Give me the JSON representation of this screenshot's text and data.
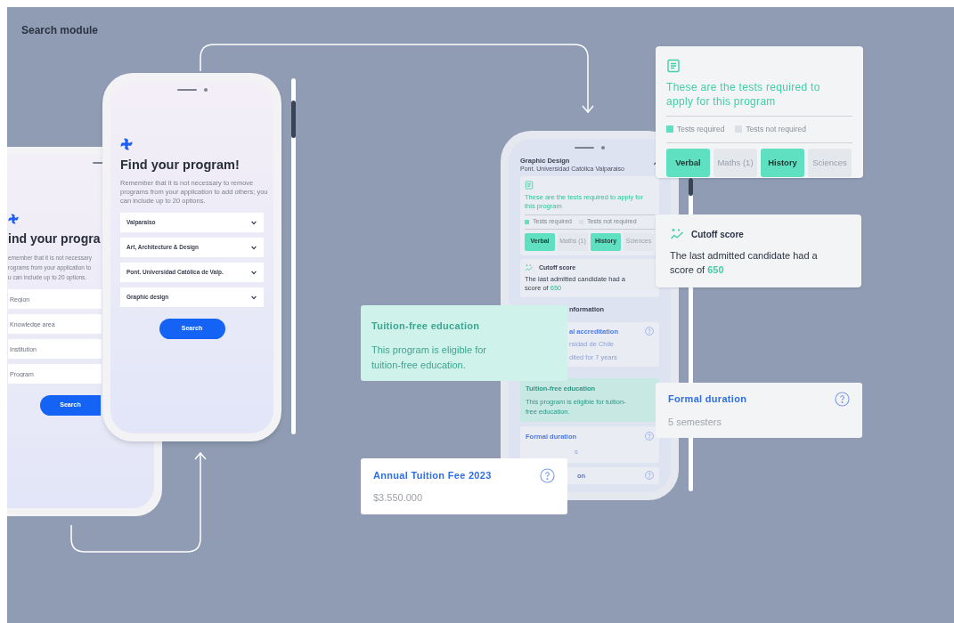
{
  "title": "Search module",
  "phone_left": {
    "heading": "ind your progra",
    "description_lines": [
      "emember that it is not necessary",
      "rograms from your application to",
      "u can include up to 20 options."
    ],
    "fields": [
      {
        "placeholder": "Region"
      },
      {
        "placeholder": "Knowledge area"
      },
      {
        "placeholder": "Institution"
      },
      {
        "placeholder": "Program"
      }
    ],
    "button": "Search"
  },
  "phone_main": {
    "heading": "Find your program!",
    "description": "Remember that it is not necessary to remove programs from your application to add others; you can include up to 20 options.",
    "selects": [
      {
        "value": "Valparaiso"
      },
      {
        "value": "Art, Architecture & Design"
      },
      {
        "value": "Pont. Universidad Católica de Valp."
      },
      {
        "value": "Graphic design"
      }
    ],
    "button": "Search"
  },
  "phone_detail": {
    "program": "Graphic Design",
    "institution": "Pont. Universidad Católica Valparaiso",
    "expanded": true,
    "tests": {
      "title": "These are the tests required to apply for this program",
      "legend": [
        {
          "label": "Tests required",
          "color": "#5fe0c0"
        },
        {
          "label": "Tests not required",
          "color": "#dcdfe5"
        }
      ],
      "chips": [
        {
          "label": "Verbal",
          "required": true
        },
        {
          "label": "Maths (1)",
          "required": false
        },
        {
          "label": "History",
          "required": true
        },
        {
          "label": "Sciences",
          "required": false
        }
      ]
    },
    "cutoff": {
      "title": "Cutoff score",
      "text": "The last admitted candidate had a score of",
      "score": "650"
    },
    "general_info": "nformation",
    "accreditation": {
      "title": "al accreditation",
      "lines": [
        "rsidad de Chile",
        "dited for 7 years"
      ]
    },
    "tuition_free": {
      "title": "Tuition-free education",
      "text": "This program is eligible for tuition-free education."
    },
    "formal_duration": {
      "title": "Formal duration",
      "value": "s"
    },
    "last_item": "on"
  },
  "cards": {
    "tests": {
      "title": "These are the tests required to apply for this program",
      "legend": [
        {
          "label": "Tests required",
          "color": "#5fe0c0"
        },
        {
          "label": "Tests not required",
          "color": "#dcdfe5"
        }
      ],
      "chips": [
        {
          "label": "Verbal",
          "required": true
        },
        {
          "label": "Maths (1)",
          "required": false
        },
        {
          "label": "History",
          "required": true
        },
        {
          "label": "Sciences",
          "required": false
        }
      ]
    },
    "cutoff": {
      "title": "Cutoff score",
      "text": "The last admitted candidate had a score of",
      "score": "650"
    },
    "tuition_free": {
      "title": "Tuition-free education",
      "text": "This program is eligible for tuition-free education."
    },
    "annual_fee": {
      "title": "Annual Tuition Fee 2023",
      "value": "$3.550.000"
    },
    "formal_duration": {
      "title": "Formal duration",
      "value": "5 semesters"
    }
  }
}
